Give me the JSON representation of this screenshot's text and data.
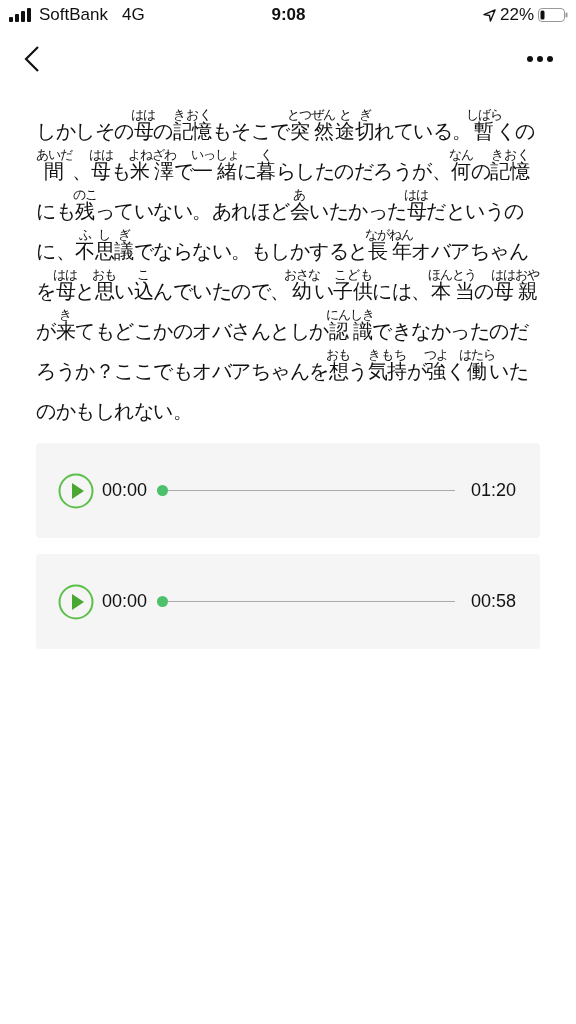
{
  "status_bar": {
    "carrier": "SoftBank",
    "network": "4G",
    "time": "9:08",
    "battery": "22%"
  },
  "article": {
    "segments": [
      {
        "text": "しかしその"
      },
      {
        "text": "母",
        "ruby": "はは"
      },
      {
        "text": "の"
      },
      {
        "text": "記憶",
        "ruby": "きおく"
      },
      {
        "text": "もそこで"
      },
      {
        "text": "突然",
        "ruby": "とつぜん"
      },
      {
        "text": "途",
        "ruby": "と"
      },
      {
        "text": "切",
        "ruby": "ぎ"
      },
      {
        "text": "れている。"
      },
      {
        "text": "暫",
        "ruby": "しばら"
      },
      {
        "text": "くの"
      },
      {
        "text": "間",
        "ruby": "あいだ"
      },
      {
        "text": " 、"
      },
      {
        "text": "母",
        "ruby": "はは"
      },
      {
        "text": "も"
      },
      {
        "text": "米澤",
        "ruby": "よねざわ"
      },
      {
        "text": "で"
      },
      {
        "text": "一緒",
        "ruby": "いっしょ"
      },
      {
        "text": "に"
      },
      {
        "text": "暮",
        "ruby": "く"
      },
      {
        "text": "らしたのだろうが、"
      },
      {
        "text": "何",
        "ruby": "なん"
      },
      {
        "text": "の"
      },
      {
        "text": "記憶",
        "ruby": "きおく"
      },
      {
        "text": "にも"
      },
      {
        "text": "残",
        "ruby": "のこ"
      },
      {
        "text": "っていない。あれほど"
      },
      {
        "text": "会",
        "ruby": "あ"
      },
      {
        "text": "いたかった"
      },
      {
        "text": "母",
        "ruby": "はは"
      },
      {
        "text": "だというのに、"
      },
      {
        "text": "不思議",
        "ruby": "ふしぎ"
      },
      {
        "text": "でならない。もしかすると"
      },
      {
        "text": "長年",
        "ruby": "ながねん"
      },
      {
        "text": "オバアちゃんを"
      },
      {
        "text": "母",
        "ruby": "はは"
      },
      {
        "text": "と"
      },
      {
        "text": "思",
        "ruby": "おも"
      },
      {
        "text": "い"
      },
      {
        "text": "込",
        "ruby": "こ"
      },
      {
        "text": "んでいたので、"
      },
      {
        "text": "幼",
        "ruby": "おさな"
      },
      {
        "text": "い"
      },
      {
        "text": "子供",
        "ruby": "こども"
      },
      {
        "text": "には、"
      },
      {
        "text": "本当",
        "ruby": "ほんとう"
      },
      {
        "text": "の"
      },
      {
        "text": "母親",
        "ruby": "ははおや"
      },
      {
        "text": "が"
      },
      {
        "text": "来",
        "ruby": "き"
      },
      {
        "text": "てもどこかのオバさんとしか"
      },
      {
        "text": "認識",
        "ruby": "にんしき"
      },
      {
        "text": "できなかったのだろうか？ここでもオバアちゃんを"
      },
      {
        "text": "想",
        "ruby": "おも"
      },
      {
        "text": "う"
      },
      {
        "text": "気持",
        "ruby": "きもち"
      },
      {
        "text": "が"
      },
      {
        "text": "強",
        "ruby": "つよ"
      },
      {
        "text": "く"
      },
      {
        "text": "働",
        "ruby": "はたら"
      },
      {
        "text": "いたのかもしれない。"
      }
    ]
  },
  "players": [
    {
      "elapsed": "00:00",
      "duration": "01:20",
      "level": 0
    },
    {
      "elapsed": "00:00",
      "duration": "00:58",
      "level": 0
    }
  ]
}
